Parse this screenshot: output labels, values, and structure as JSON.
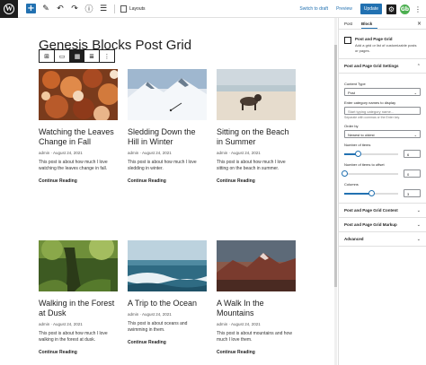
{
  "toolbar": {
    "logo_glyph": "W",
    "add_glyph": "+",
    "icons": [
      "pencil-icon",
      "undo-icon",
      "redo-icon",
      "info-icon",
      "list-view-icon"
    ],
    "document_title": "Layouts",
    "save_draft": "Switch to draft",
    "preview": "Preview",
    "update": "Update",
    "gb_glyph": "Gb",
    "accent_color": "#2271b1"
  },
  "editor": {
    "post_title": "Genesis Blocks Post Grid",
    "posts": [
      {
        "title": "Watching the Leaves Change in Fall",
        "meta": "admin · August 24, 2021",
        "excerpt": "This post is about how much I love watching the leaves change in fall.",
        "more": "Continue Reading",
        "image": "autumn-leaves"
      },
      {
        "title": "Sledding Down the Hill in Winter",
        "meta": "admin · August 24, 2021",
        "excerpt": "This post is about how much I love sledding in winter.",
        "more": "Continue Reading",
        "image": "snowy-mountain"
      },
      {
        "title": "Sitting on the Beach in Summer",
        "meta": "admin · August 24, 2021",
        "excerpt": "This post is about how much I love sitting on the beach in summer.",
        "more": "Continue Reading",
        "image": "beach-dog"
      },
      {
        "title": "Walking in the Forest at Dusk",
        "meta": "admin · August 24, 2021",
        "excerpt": "This post is about how much I love walking in the forest at dusk.",
        "more": "Continue Reading",
        "image": "mossy-forest"
      },
      {
        "title": "A Trip to the Ocean",
        "meta": "admin · August 24, 2021",
        "excerpt": "This post is about oceans and swimming in them.",
        "more": "Continue Reading",
        "image": "ocean-waves"
      },
      {
        "title": "A Walk In the Mountains",
        "meta": "admin · August 24, 2021",
        "excerpt": "This post is about mountains and how much I love them.",
        "more": "Continue Reading",
        "image": "sunset-mountains"
      }
    ]
  },
  "sidebar": {
    "tabs": [
      "Post",
      "Block"
    ],
    "active_tab": "Block",
    "close_glyph": "×",
    "block_name": "Post and Page Grid",
    "block_desc": "Add a grid or list of customizable posts or pages.",
    "settings_title": "Post and Page Grid Settings",
    "content_type_label": "Content Type",
    "content_type_value": "Post",
    "category_label": "Enter category names to display",
    "category_placeholder": "Start typing category name...",
    "category_help": "Separate with commas or the Enter key.",
    "order_label": "Order by",
    "order_value": "Newest to oldest",
    "items_label": "Number of items",
    "items_value": "6",
    "offset_label": "Number of items to offset",
    "offset_value": "0",
    "columns_label": "Columns",
    "columns_value": "3",
    "panel_content": "Post and Page Grid Content",
    "panel_markup": "Post and Page Grid Markup",
    "panel_advanced": "Advanced",
    "chevron": "⌄",
    "chevron_up": "⌃",
    "slider_levels": {
      "items": 0.25,
      "offset": 0.0,
      "columns": 0.5
    }
  }
}
